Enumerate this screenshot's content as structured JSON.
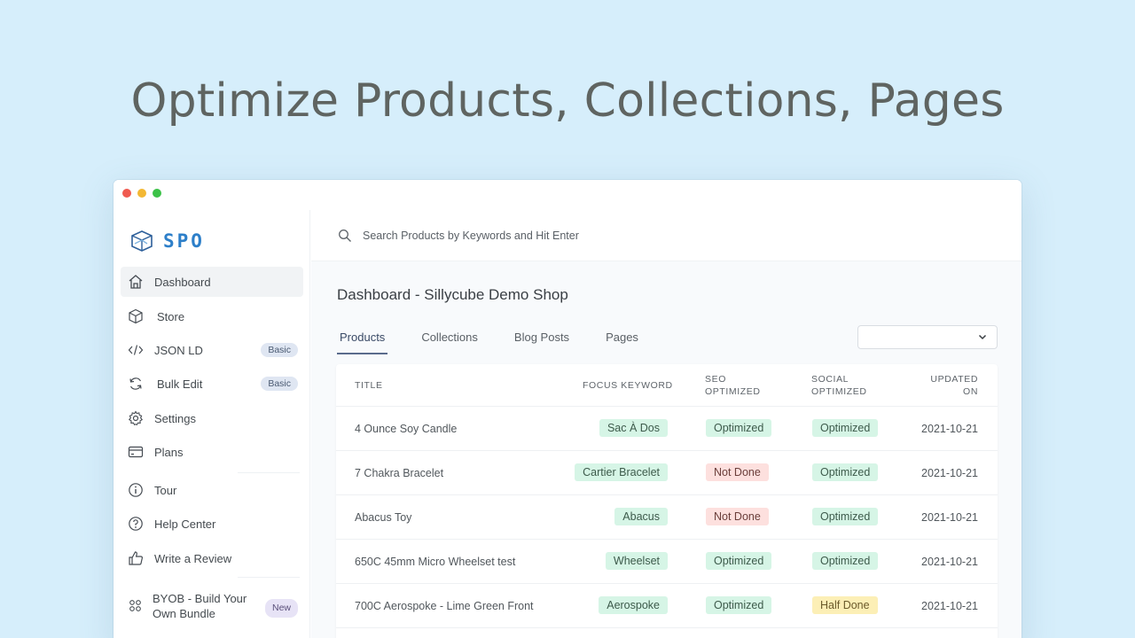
{
  "headline": "Optimize Products, Collections, Pages",
  "colors": {
    "accent": "#2d7fc9",
    "background": "#d6eefb",
    "ok": "#d6f5e6",
    "not_done": "#fde0de",
    "half": "#fcefb6"
  },
  "app": {
    "logo_text": "SPO",
    "logo_icon": "cube-logo-icon"
  },
  "sidebar": {
    "items": [
      {
        "label": "Dashboard",
        "icon": "home-icon"
      },
      {
        "label": "Store",
        "icon": "box-icon"
      },
      {
        "label": "JSON LD",
        "icon": "code-icon",
        "badge": "Basic"
      },
      {
        "label": "Bulk Edit",
        "icon": "refresh-icon",
        "badge": "Basic"
      },
      {
        "label": "Settings",
        "icon": "gear-icon"
      },
      {
        "label": "Plans",
        "icon": "card-icon"
      },
      {
        "label": "Tour",
        "icon": "info-icon"
      },
      {
        "label": "Help Center",
        "icon": "help-icon"
      },
      {
        "label": "Write a Review",
        "icon": "thumbs-up-icon"
      },
      {
        "label": "BYOB - Build Your",
        "label2": "Own Bundle",
        "icon": "grid-icon",
        "badge": "New"
      }
    ]
  },
  "search": {
    "placeholder": "Search Products by Keywords and Hit Enter",
    "value": ""
  },
  "page_title": "Dashboard - Sillycube Demo Shop",
  "tabs": [
    "Products",
    "Collections",
    "Blog Posts",
    "Pages"
  ],
  "filter_select": {
    "value": ""
  },
  "table": {
    "headers": {
      "title": "TITLE",
      "focus": "FOCUS KEYWORD",
      "seo1": "SEO",
      "seo2": "OPTIMIZED",
      "social1": "SOCIAL",
      "social2": "OPTIMIZED",
      "updated1": "UPDATED",
      "updated2": "ON"
    },
    "rows": [
      {
        "title": "4 Ounce Soy Candle",
        "keyword": "Sac À Dos",
        "seo": "Optimized",
        "seo_status": "green",
        "social": "Optimized",
        "social_status": "green",
        "updated": "2021-10-21"
      },
      {
        "title": "7 Chakra Bracelet",
        "keyword": "Cartier Bracelet",
        "seo": "Not Done",
        "seo_status": "red",
        "social": "Optimized",
        "social_status": "green",
        "updated": "2021-10-21"
      },
      {
        "title": "Abacus Toy",
        "keyword": "Abacus",
        "seo": "Not Done",
        "seo_status": "red",
        "social": "Optimized",
        "social_status": "green",
        "updated": "2021-10-21"
      },
      {
        "title": "650C 45mm Micro Wheelset test",
        "keyword": "Wheelset",
        "seo": "Optimized",
        "seo_status": "green",
        "social": "Optimized",
        "social_status": "green",
        "updated": "2021-10-21"
      },
      {
        "title": "700C Aerospoke - Lime Green Front",
        "keyword": "Aerospoke",
        "seo": "Optimized",
        "seo_status": "green",
        "social": "Half Done",
        "social_status": "yellow",
        "updated": "2021-10-21"
      }
    ]
  }
}
